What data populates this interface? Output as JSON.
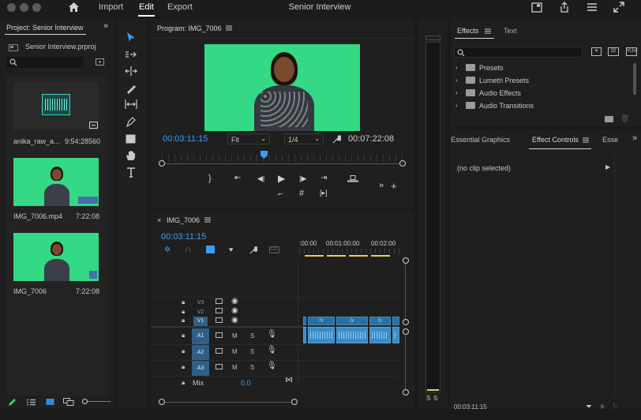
{
  "menu": {
    "import": "Import",
    "edit": "Edit",
    "export": "Export",
    "title": "Senior Interview"
  },
  "project": {
    "panel_title": "Project: Senior Interview",
    "file_name": "Senior Interview.prproj",
    "search_placeholder": "",
    "items": [
      {
        "name": "anika_raw_a...",
        "duration": "9:54:28560"
      },
      {
        "name": "IMG_7006.mp4",
        "duration": "7:22:08"
      },
      {
        "name": "IMG_7006",
        "duration": "7:22:08"
      }
    ]
  },
  "program": {
    "title": "Program: IMG_7006",
    "timecode": "00:03:11:15",
    "fit": "Fit",
    "resolution": "1/4",
    "duration": "00:07:22:08"
  },
  "timeline": {
    "sequence": "IMG_7006",
    "timecode": "00:03:11:15",
    "ruler": [
      ":00:00",
      "00:01:00:00",
      "00:02:00"
    ],
    "video_tracks": [
      "V3",
      "V2",
      "V1"
    ],
    "audio_tracks": [
      "A1",
      "A2",
      "A3"
    ],
    "mix_label": "Mix",
    "mix_value": "0.0",
    "m_label": "M",
    "s_label": "S",
    "fx_label": "fx"
  },
  "meter": {
    "s1": "S",
    "s2": "S"
  },
  "effects": {
    "tab_effects": "Effects",
    "tab_text": "Text",
    "folders": [
      "Presets",
      "Lumetri Presets",
      "Audio Effects",
      "Audio Transitions"
    ]
  },
  "lower_right": {
    "tab_essential_graphics": "Essential Graphics",
    "tab_effect_controls": "Effect Controls",
    "tab_essential_cut": "Esse",
    "no_clip": "(no clip selected)",
    "timecode": "00:03:11:15"
  },
  "colors": {
    "accent": "#3c9cf2",
    "green_screen": "#33d984",
    "track_on": "#2e5f87",
    "clip": "#3a8cc8"
  }
}
